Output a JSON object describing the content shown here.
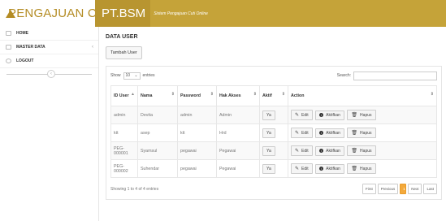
{
  "header": {
    "brand_part1": "PENGAJUAN CUTI",
    "brand_part2": "PT.BSM",
    "subtitle": "Sistem Pengajuan Cuti Online",
    "colors": {
      "gold": "#c5a339",
      "brand_text": "#b48c24"
    }
  },
  "sidebar": {
    "items": [
      {
        "label": "HOME",
        "icon": "home-icon"
      },
      {
        "label": "MASTER DATA",
        "icon": "database-icon",
        "chevron": "‹"
      },
      {
        "label": "LOGOUT",
        "icon": "logout-icon"
      }
    ],
    "collapse_symbol": "‹"
  },
  "main": {
    "title": "DATA USER",
    "add_button": "Tambah User",
    "show_label": "Show",
    "entries_value": "10",
    "entries_label": "entries",
    "search_label": "Search:",
    "columns": [
      "ID User",
      "Nama",
      "Password",
      "Hak Akses",
      "Aktif",
      "Action"
    ],
    "rows": [
      {
        "id": "admin",
        "nama": "Devita",
        "password": "admin",
        "hak": "Admin",
        "aktif": "Ya"
      },
      {
        "id": "ktt",
        "nama": "asep",
        "password": "ktt",
        "hak": "Hrd",
        "aktif": "Ya"
      },
      {
        "id": "PEG-000001",
        "nama": "Syamsul",
        "password": "pegawai",
        "hak": "Pegawai",
        "aktif": "Ya"
      },
      {
        "id": "PEG-000002",
        "nama": "Suhendar",
        "password": "pegawai",
        "hak": "Pegawai",
        "aktif": "Ya"
      }
    ],
    "actions": {
      "edit": "Edit",
      "aktifkan": "Aktifkan",
      "hapus": "Hapus"
    },
    "info": "Showing 1 to 4 of 4 entries",
    "pager": {
      "first": "First",
      "previous": "Previous",
      "current": "1",
      "next": "Next",
      "last": "Last"
    },
    "accent": "#f3a93b"
  }
}
